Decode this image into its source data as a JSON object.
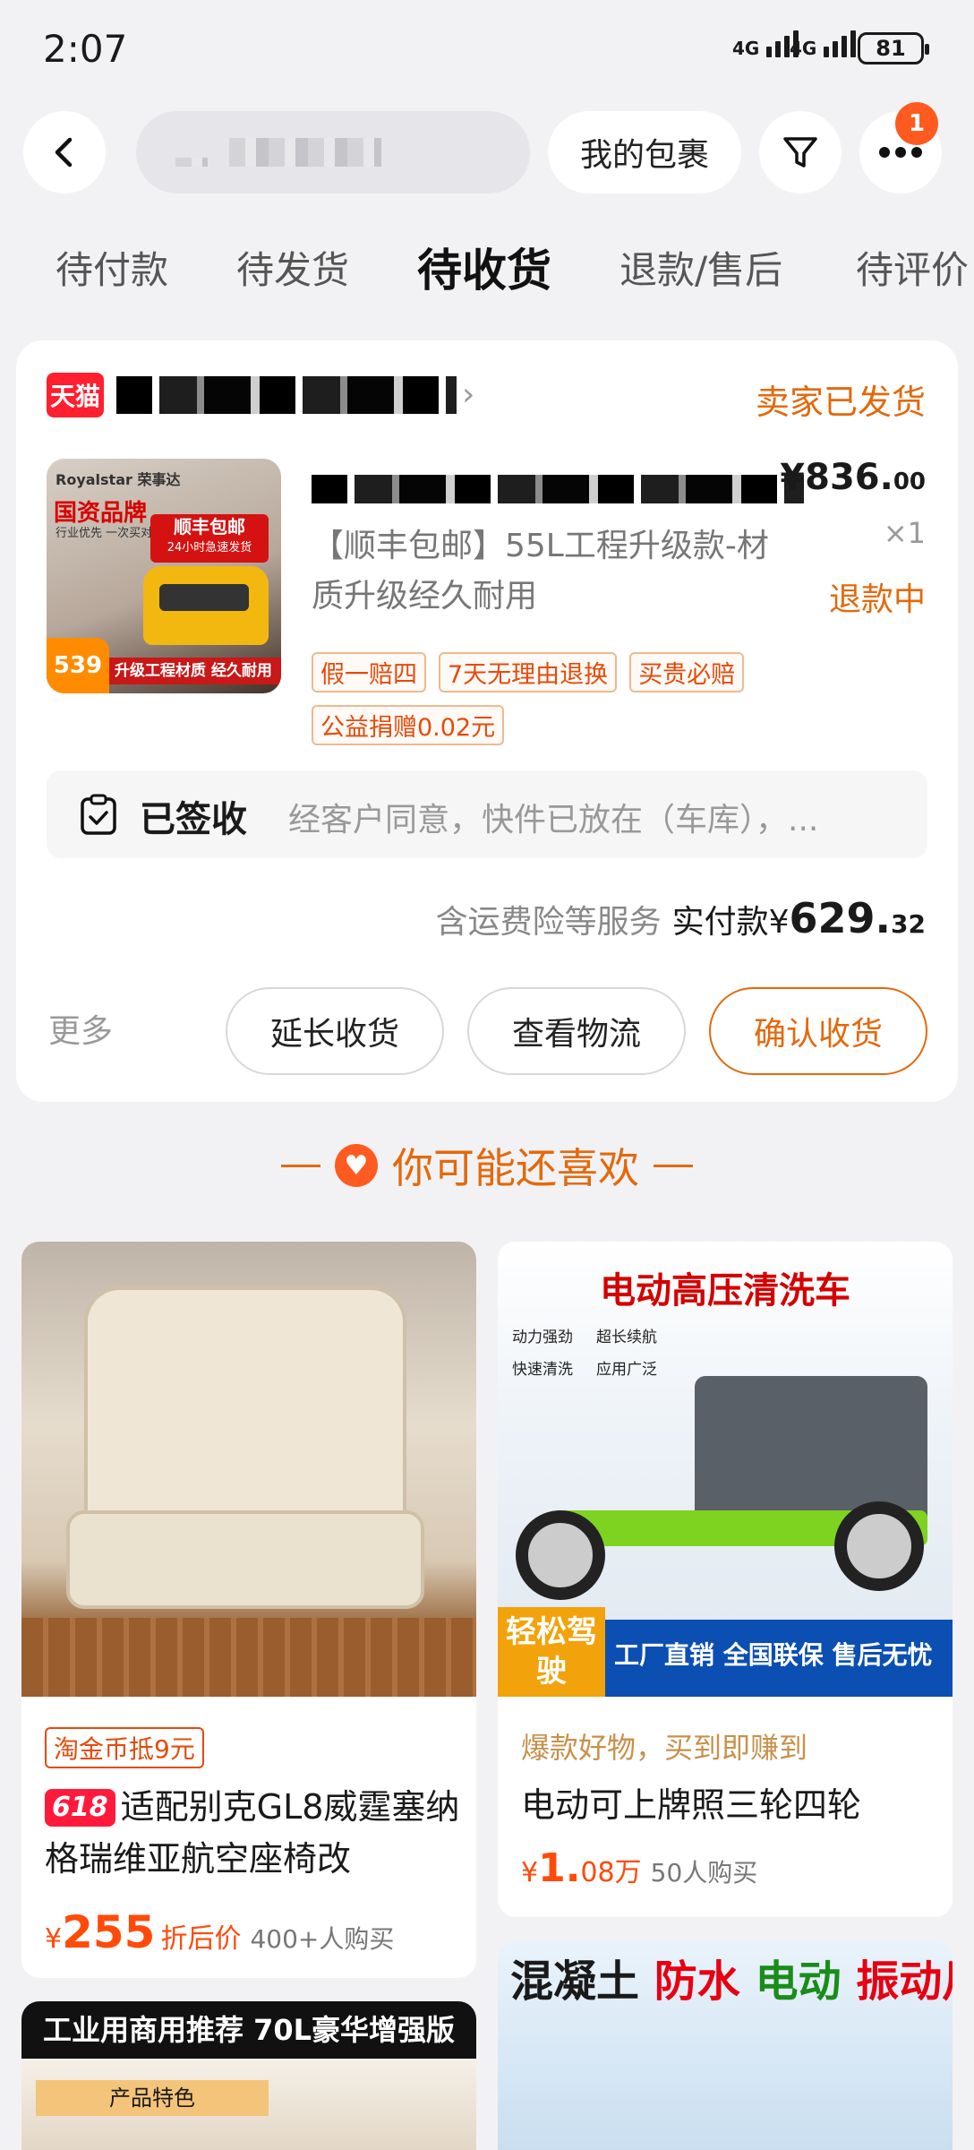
{
  "status_bar": {
    "time": "2:07",
    "signal1": "4G",
    "signal2": "4G",
    "battery": "81"
  },
  "header": {
    "my_packages": "我的包裹",
    "notification_count": "1"
  },
  "tabs": [
    {
      "label": "待付款"
    },
    {
      "label": "待发货"
    },
    {
      "label": "待收货",
      "active": true
    },
    {
      "label": "退款/售后"
    },
    {
      "label": "待评价"
    }
  ],
  "order": {
    "store_badge": "天猫",
    "status": "卖家已发货",
    "thumbnail": {
      "brand": "Royalstar 荣事达",
      "headline": "国资品牌",
      "sub": "行业优先 一次买对",
      "badge_line1": "顺丰包邮",
      "badge_line2": "24小时急速发货",
      "strip": "升级工程材质 经久耐用",
      "price": "539"
    },
    "product_title": "【顺丰包邮】55L工程升级款-材质升级经久耐用",
    "price_main": "¥836.",
    "price_decimal": "00",
    "quantity": "×1",
    "refund_status": "退款中",
    "tags": [
      "假一赔四",
      "7天无理由退换",
      "买贵必赔",
      "公益捐赠0.02元"
    ],
    "signed_label": "已签收",
    "signed_text": "经客户同意，快件已放在（车库），...",
    "total_note": "含运费险等服务",
    "total_label": "实付款¥",
    "total_int": "629.",
    "total_dec": "32",
    "more": "更多",
    "buttons": {
      "extend": "延长收货",
      "logistics": "查看物流",
      "confirm": "确认收货"
    }
  },
  "recommend": {
    "title": "你可能还喜欢",
    "items": [
      {
        "coupon": "淘金币抵9元",
        "badge": "618",
        "title": "适配别克GL8威霆塞纳格瑞维亚航空座椅改",
        "currency": "¥",
        "price": "255",
        "price_note": "折后价",
        "sold": "400+人购买"
      },
      {
        "image_title": "电动高压清洗车",
        "features": [
          "动力强劲",
          "超长续航",
          "快速清洗",
          "应用广泛"
        ],
        "image_ease": "轻松驾驶",
        "image_band": "工厂直销 全国联保 售后无忧",
        "hot": "爆款好物，买到即赚到",
        "title": "电动可上牌照三轮四轮",
        "currency": "¥",
        "price": "1.",
        "price_unit": "08万",
        "sold": "50人购买"
      },
      {
        "image_banner": "工业用商用推荐 70L豪华增强版",
        "image_feature": "产品特色"
      },
      {
        "image_title_parts": [
          "混凝土",
          "防水",
          "电动",
          "振动尺"
        ]
      }
    ]
  },
  "colors": {
    "accent": "#e3690c",
    "price_red": "#ff4a0a",
    "tmall_red": "#ff1f2f"
  }
}
